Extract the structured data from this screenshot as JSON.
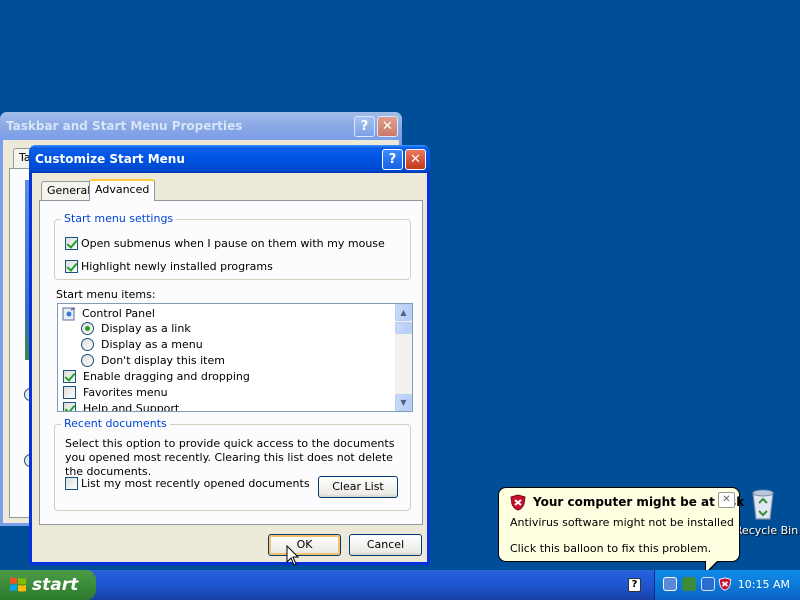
{
  "desktop": {
    "recycle_bin_label": "Recycle Bin"
  },
  "back_window": {
    "title": "Taskbar and Start Menu Properties",
    "tab_fragment": "Ta",
    "help_label": "?",
    "close_label": "✕"
  },
  "dialog": {
    "title": "Customize Start Menu",
    "help_label": "?",
    "close_label": "✕",
    "tabs": [
      {
        "label": "General"
      },
      {
        "label": "Advanced",
        "active": true
      }
    ],
    "settings_group": {
      "title": "Start menu settings",
      "options": [
        {
          "label": "Open submenus when I pause on them with my mouse",
          "checked": true
        },
        {
          "label": "Highlight newly installed programs",
          "checked": true
        }
      ]
    },
    "items": {
      "label": "Start menu items:",
      "rows": [
        {
          "label": "Control Panel"
        },
        {
          "label": "Display as a link"
        },
        {
          "label": "Display as a menu"
        },
        {
          "label": "Don't display this item"
        },
        {
          "label": "Enable dragging and dropping"
        },
        {
          "label": "Favorites menu"
        },
        {
          "label": "Help and Support"
        }
      ]
    },
    "recent_group": {
      "title": "Recent documents",
      "description": "Select this option to provide quick access to the documents you opened most recently.  Clearing this list does not delete the documents.",
      "checkbox_label": "List my most recently opened documents",
      "clear_label": "Clear List"
    },
    "ok_label": "OK",
    "cancel_label": "Cancel"
  },
  "balloon": {
    "title": "Your computer might be at risk",
    "line1": "Antivirus software might not be installed",
    "line2": "Click this balloon to fix this problem.",
    "close_label": "✕"
  },
  "taskbar": {
    "start_label": "start",
    "help_icon_label": "?",
    "clock": "10:15 AM"
  },
  "colors": {
    "desktop": "#004e98",
    "title_active": "#0054e3",
    "start_green": "#3c8a3a",
    "tray_blue": "#0c7ad8",
    "balloon_bg": "#ffffe1",
    "shield_red": "#c8102e"
  }
}
